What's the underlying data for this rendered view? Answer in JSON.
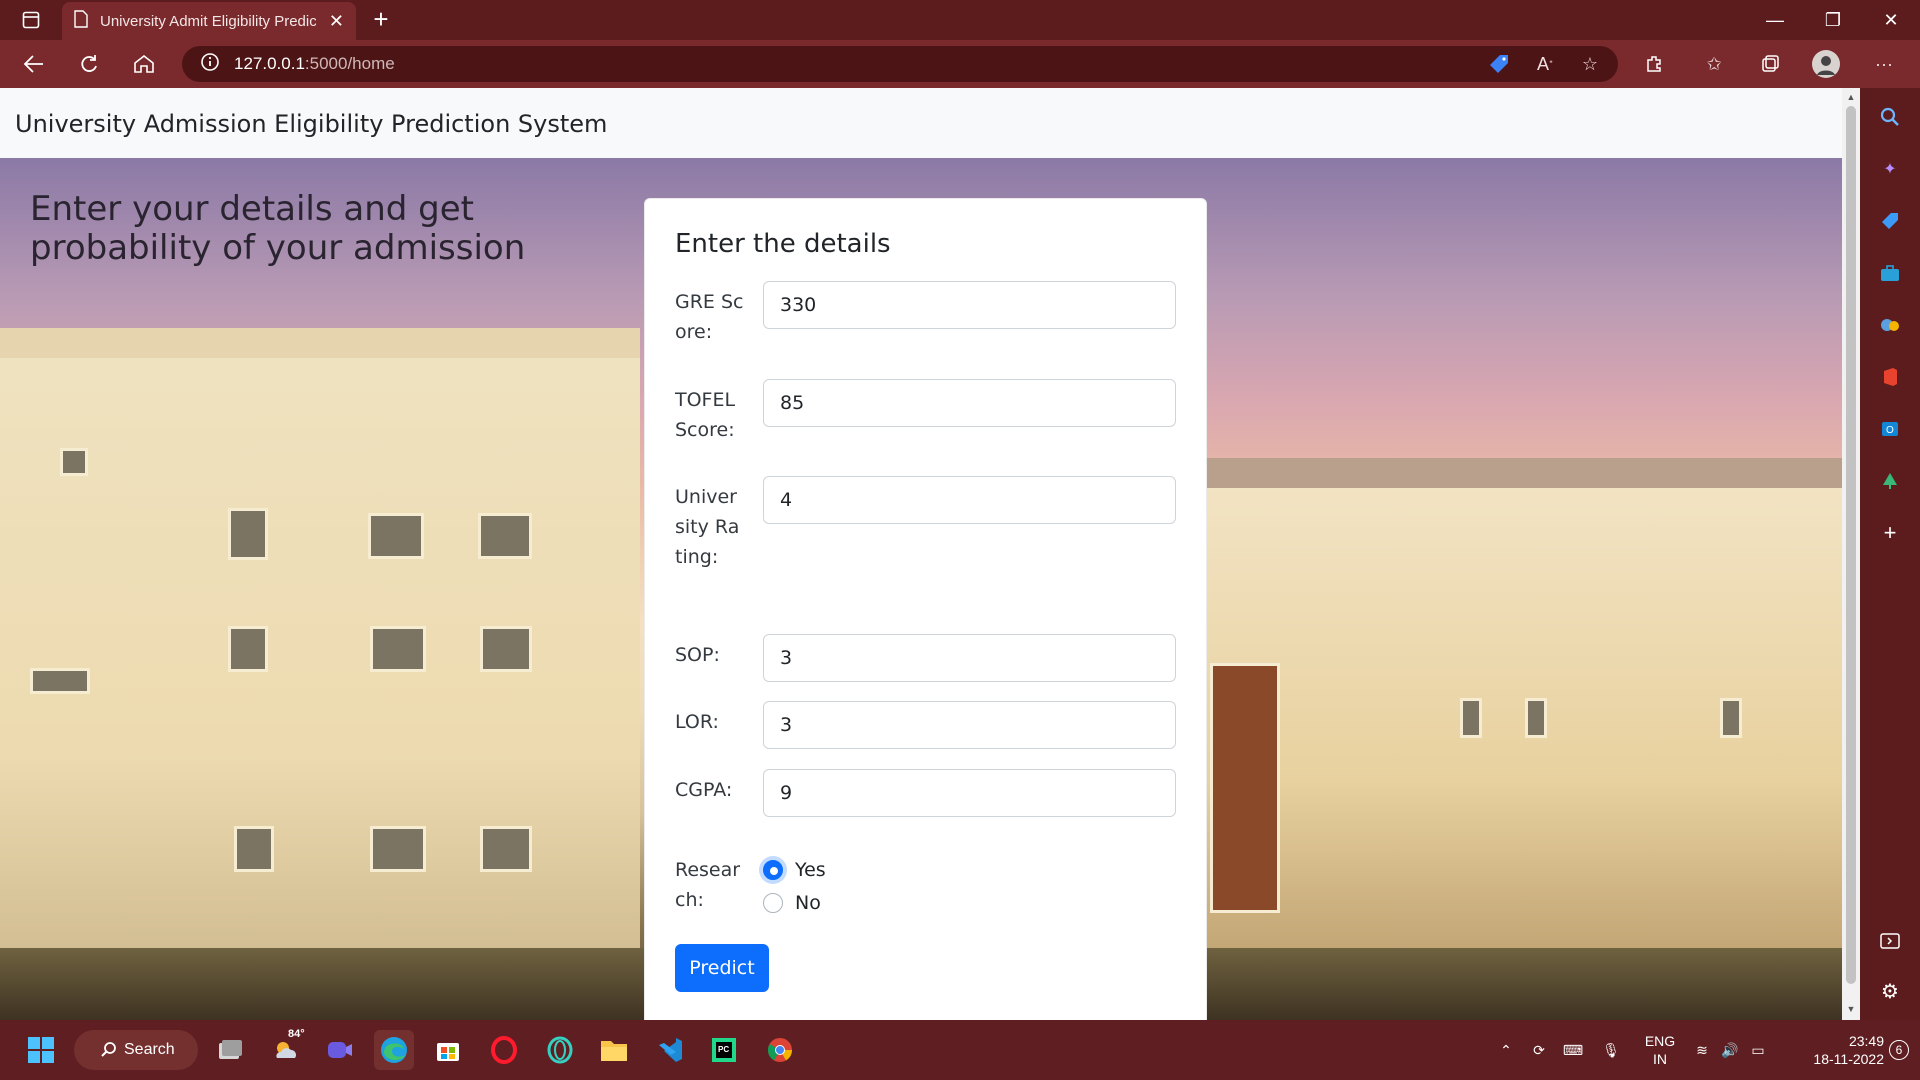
{
  "browser": {
    "tab_title": "University Admit Eligibility Predic",
    "url_host": "127.0.0.1",
    "url_path": ":5000/home"
  },
  "page": {
    "navbar_brand": "University Admission Eligibility Prediction System",
    "hero_heading": "Enter your details and get probability of your admission",
    "form": {
      "title": "Enter the details",
      "fields": [
        {
          "label": "GRE Score:",
          "value": "330"
        },
        {
          "label": "TOFEL Score:",
          "value": "85"
        },
        {
          "label": "University Rating:",
          "value": "4"
        },
        {
          "label": "SOP:",
          "value": "3"
        },
        {
          "label": "LOR:",
          "value": "3"
        },
        {
          "label": "CGPA:",
          "value": "9"
        }
      ],
      "research_label": "Research:",
      "research_options": [
        "Yes",
        "No"
      ],
      "research_selected": "Yes",
      "submit_label": "Predict"
    }
  },
  "taskbar": {
    "search_label": "Search",
    "weather": "84°",
    "lang": "ENG",
    "region": "IN",
    "time": "23:49",
    "date": "18-11-2022",
    "notification_count": "6"
  },
  "colors": {
    "browser_frame": "#5c1c1e",
    "primary_button": "#0d6efd"
  }
}
